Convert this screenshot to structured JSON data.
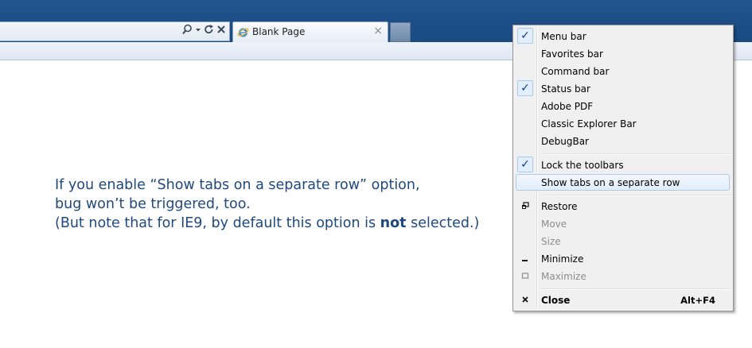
{
  "browser": {
    "tab_title": "Blank Page",
    "tab_close": "×",
    "address_icons": [
      "search-icon",
      "dropdown-icon",
      "refresh-icon",
      "stop-icon"
    ]
  },
  "note": {
    "line1": "If you enable “Show tabs on a separate row” option,",
    "line2": "bug won’t be triggered, too.",
    "line3_before": "(But note that for IE9, by default this option is ",
    "line3_bold": "not",
    "line3_after": " selected.)"
  },
  "context_menu": {
    "items": [
      {
        "label": "Menu bar",
        "checked": true,
        "enabled": true
      },
      {
        "label": "Favorites bar",
        "checked": false,
        "enabled": true
      },
      {
        "label": "Command bar",
        "checked": false,
        "enabled": true
      },
      {
        "label": "Status bar",
        "checked": true,
        "enabled": true
      },
      {
        "label": "Adobe PDF",
        "checked": false,
        "enabled": true
      },
      {
        "label": "Classic Explorer Bar",
        "checked": false,
        "enabled": true
      },
      {
        "label": "DebugBar",
        "checked": false,
        "enabled": true
      },
      {
        "label": "Lock the toolbars",
        "checked": true,
        "enabled": true
      },
      {
        "label": "Show tabs on a separate row",
        "checked": false,
        "enabled": true,
        "highlighted": true
      },
      {
        "label": "Restore",
        "enabled": true
      },
      {
        "label": "Move",
        "enabled": false
      },
      {
        "label": "Size",
        "enabled": false
      },
      {
        "label": "Minimize",
        "enabled": true
      },
      {
        "label": "Maximize",
        "enabled": false
      },
      {
        "label": "Close",
        "enabled": true,
        "shortcut": "Alt+F4"
      }
    ],
    "check_glyph": "✓",
    "accent_color": "#0c3c96"
  },
  "colors": {
    "title_bar": "#1d4e87",
    "note_text": "#1f497d",
    "menu_bg": "#f0f0f0",
    "highlight_border": "#a8cbee"
  }
}
